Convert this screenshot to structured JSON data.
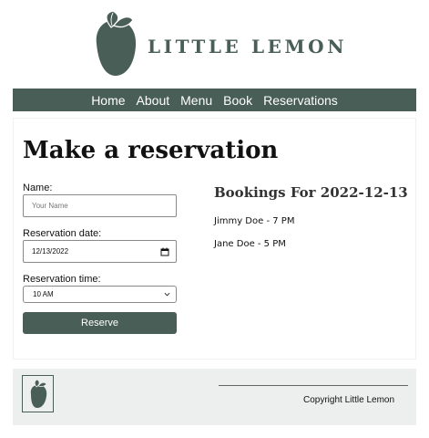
{
  "header": {
    "brand_name": "LITTLE LEMON",
    "logo_icon": "lemon-logo-icon"
  },
  "nav": {
    "items": [
      {
        "label": "Home"
      },
      {
        "label": "About"
      },
      {
        "label": "Menu"
      },
      {
        "label": "Book"
      },
      {
        "label": "Reservations"
      }
    ]
  },
  "reservation": {
    "title": "Make a reservation",
    "name_label": "Name:",
    "name_placeholder": "Your Name",
    "name_value": "",
    "date_label": "Reservation date:",
    "date_value": "12/13/2022",
    "time_label": "Reservation time:",
    "time_value": "10 AM",
    "submit_label": "Reserve"
  },
  "bookings": {
    "title": "Bookings For 2022-12-13",
    "items": [
      "Jimmy Doe - 7 PM",
      "Jane Doe - 5 PM"
    ]
  },
  "footer": {
    "logo_icon": "lemon-logo-icon",
    "copyright": "Copyright Little Lemon"
  },
  "colors": {
    "brand_green": "#495e57",
    "footer_bg": "#edefee",
    "white": "#ffffff"
  }
}
